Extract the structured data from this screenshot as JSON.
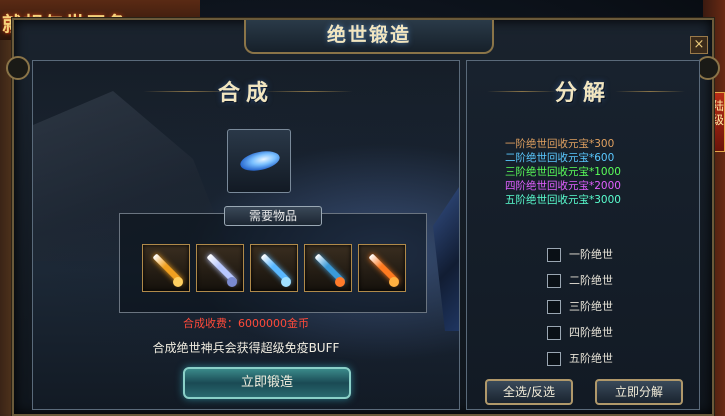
{
  "promo_banner": "就想与世无争",
  "side_badge": "大陆升级",
  "window": {
    "title": "绝世锻造",
    "close_label": "×"
  },
  "synthesis": {
    "title": "合成",
    "materials_label": "需要物品",
    "materials": [
      {
        "name": "sword-gold",
        "color": "#f0a020",
        "hilt": "#ffd060"
      },
      {
        "name": "sword-silver",
        "color": "#b8c8ff",
        "hilt": "#7a8ad0"
      },
      {
        "name": "sword-blue",
        "color": "#5ab8ff",
        "hilt": "#a0e0ff"
      },
      {
        "name": "sword-cyan",
        "color": "#3a9ad8",
        "hilt": "#ff7a2a"
      },
      {
        "name": "sword-flame",
        "color": "#ff7a20",
        "hilt": "#ffb040"
      }
    ],
    "cost_text": "合成收费：6000000金币",
    "info_text": "合成绝世神兵会获得超级免疫BUFF",
    "forge_button": "立即锻造"
  },
  "decompose": {
    "title": "分解",
    "rewards": [
      {
        "text": "一阶绝世回收元宝*300",
        "color": "#e0a060"
      },
      {
        "text": "二阶绝世回收元宝*600",
        "color": "#5ac8ff"
      },
      {
        "text": "三阶绝世回收元宝*1000",
        "color": "#5aff5a"
      },
      {
        "text": "四阶绝世回收元宝*2000",
        "color": "#e060ff"
      },
      {
        "text": "五阶绝世回收元宝*3000",
        "color": "#5affd0"
      }
    ],
    "options": [
      {
        "label": "一阶绝世",
        "checked": false
      },
      {
        "label": "二阶绝世",
        "checked": false
      },
      {
        "label": "三阶绝世",
        "checked": false
      },
      {
        "label": "四阶绝世",
        "checked": false
      },
      {
        "label": "五阶绝世",
        "checked": false
      }
    ],
    "select_all_button": "全选/反选",
    "decompose_button": "立即分解"
  }
}
